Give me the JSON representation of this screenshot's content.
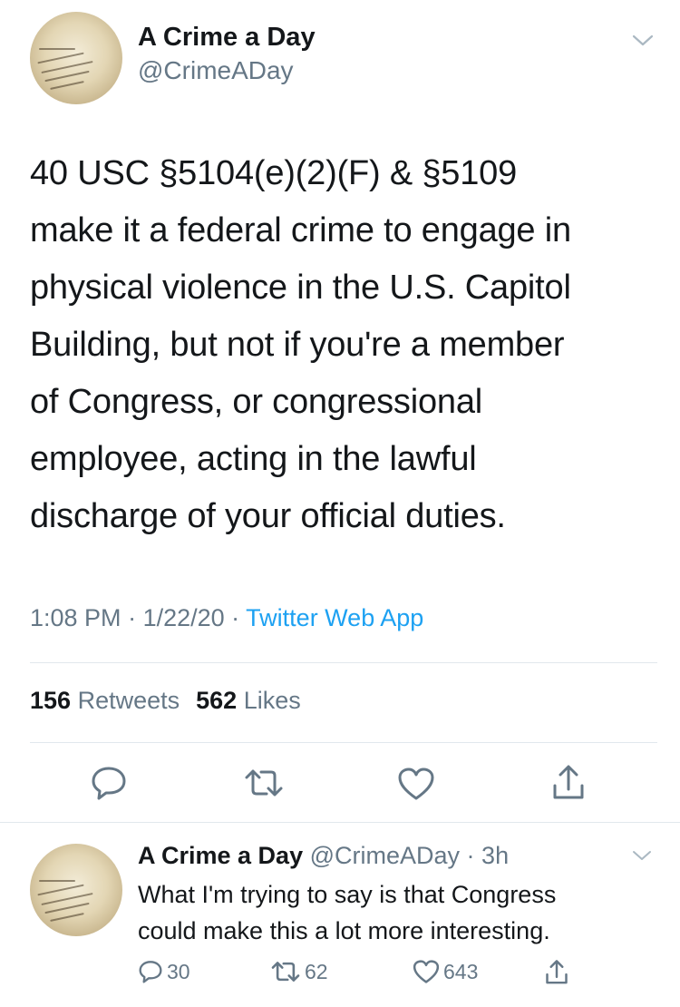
{
  "tweet": {
    "author_name": "A Crime a Day",
    "author_handle": "@CrimeADay",
    "text": "40 USC §5104(e)(2)(F) & §5109\nmake it a federal crime to engage in\nphysical violence in the U.S. Capitol\nBuilding, but not if you're a member\nof Congress, or congressional\nemployee, acting in the lawful\ndischarge of your official duties.",
    "time": "1:08 PM",
    "date": "1/22/20",
    "separator": " · ",
    "source_app": "Twitter Web App",
    "retweets_count": "156",
    "retweets_label": "Retweets",
    "likes_count": "562",
    "likes_label": "Likes"
  },
  "reply": {
    "author_name": "A Crime a Day",
    "author_handle": "@CrimeADay",
    "age": "3h",
    "separator": " · ",
    "text": "What I'm trying to say is that Congress\ncould make this a lot more interesting.",
    "reply_count": "30",
    "retweet_count": "62",
    "like_count": "643"
  },
  "icons": {
    "reply": "reply-icon",
    "retweet": "retweet-icon",
    "like": "heart-icon",
    "share": "share-icon",
    "menu": "chevron-down-icon"
  },
  "colors": {
    "link": "#1da1f2",
    "secondary_text": "#657786",
    "divider": "#e1e8ed"
  }
}
